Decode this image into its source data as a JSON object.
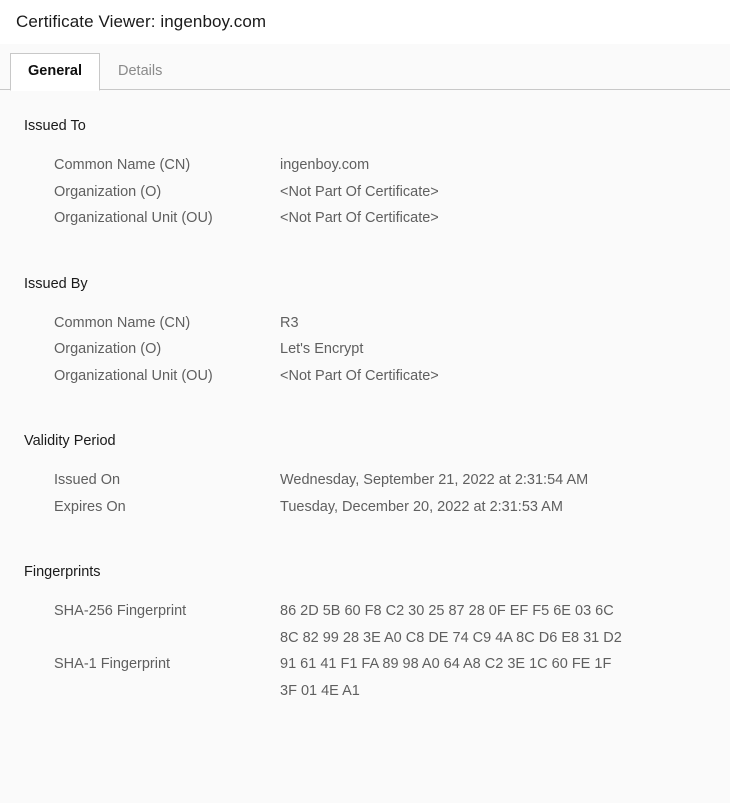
{
  "window": {
    "title": "Certificate Viewer: ingenboy.com"
  },
  "tabs": [
    {
      "label": "General",
      "active": true
    },
    {
      "label": "Details",
      "active": false
    }
  ],
  "sections": [
    {
      "title": "Issued To",
      "rows": [
        {
          "label": "Common Name (CN)",
          "value": "ingenboy.com"
        },
        {
          "label": "Organization (O)",
          "value": "<Not Part Of Certificate>"
        },
        {
          "label": "Organizational Unit (OU)",
          "value": "<Not Part Of Certificate>"
        }
      ]
    },
    {
      "title": "Issued By",
      "rows": [
        {
          "label": "Common Name (CN)",
          "value": "R3"
        },
        {
          "label": "Organization (O)",
          "value": "Let's Encrypt"
        },
        {
          "label": "Organizational Unit (OU)",
          "value": "<Not Part Of Certificate>"
        }
      ]
    },
    {
      "title": "Validity Period",
      "rows": [
        {
          "label": "Issued On",
          "value": "Wednesday, September 21, 2022 at 2:31:54 AM"
        },
        {
          "label": "Expires On",
          "value": "Tuesday, December 20, 2022 at 2:31:53 AM"
        }
      ]
    },
    {
      "title": "Fingerprints",
      "rows": [
        {
          "label": "SHA-256 Fingerprint",
          "value": "86 2D 5B 60 F8 C2 30 25 87 28 0F EF F5 6E 03 6C\n8C 82 99 28 3E A0 C8 DE 74 C9 4A 8C D6 E8 31 D2"
        },
        {
          "label": "SHA-1 Fingerprint",
          "value": "91 61 41 F1 FA 89 98 A0 64 A8 C2 3E 1C 60 FE 1F\n3F 01 4E A1"
        }
      ]
    }
  ]
}
